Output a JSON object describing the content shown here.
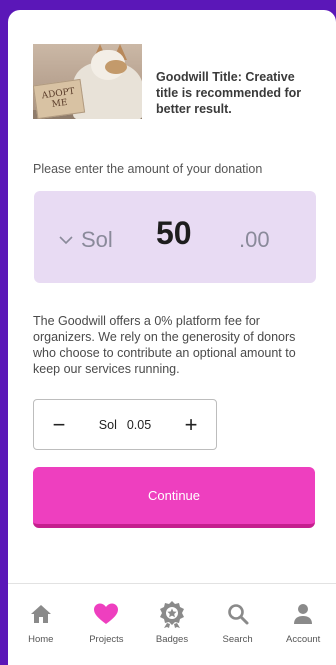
{
  "campaign": {
    "title": "Goodwill Title: Creative title is recommended for better result.",
    "image_sign_text": "ADOPT ME"
  },
  "donation": {
    "prompt": "Please enter the amount of your donation",
    "currency": "Sol",
    "amount": "50",
    "cents": ".00"
  },
  "fee": {
    "description": "The Goodwill offers a 0% platform fee for organizers. We rely on the generosity of donors who choose to contribute an optional amount to keep our services running.",
    "currency": "Sol",
    "value": "0.05",
    "minus": "−",
    "plus": "+"
  },
  "continue_label": "Continue",
  "tabs": [
    {
      "label": "Home",
      "icon": "home-icon"
    },
    {
      "label": "Projects",
      "icon": "heart-icon",
      "active": true
    },
    {
      "label": "Badges",
      "icon": "badge-icon"
    },
    {
      "label": "Search",
      "icon": "search-icon"
    },
    {
      "label": "Account",
      "icon": "account-icon"
    }
  ],
  "colors": {
    "background": "#5b17b8",
    "accent": "#ee3fbf",
    "amount_box": "#e8dbf3",
    "icon_gray": "#8a8a8a"
  }
}
